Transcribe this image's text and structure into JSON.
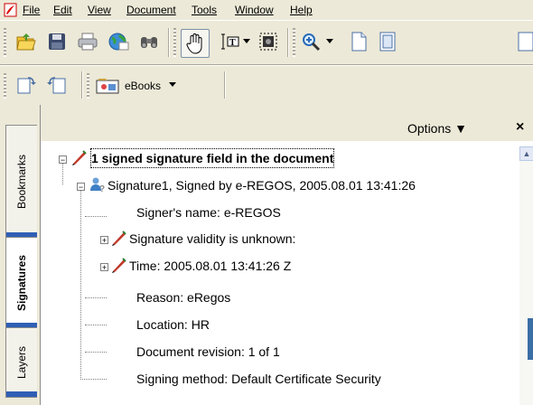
{
  "menu": {
    "items": [
      {
        "label": "File"
      },
      {
        "label": "Edit"
      },
      {
        "label": "View"
      },
      {
        "label": "Document"
      },
      {
        "label": "Tools"
      },
      {
        "label": "Window"
      },
      {
        "label": "Help"
      }
    ]
  },
  "toolbar": {
    "ebooks_label": "eBooks"
  },
  "tabs": {
    "bookmarks": "Bookmarks",
    "signatures": "Signatures",
    "layers": "Layers"
  },
  "panel": {
    "options_label": "Options ▼",
    "close_label": "×"
  },
  "tree": {
    "root": "1 signed signature field in the document",
    "signature": "Signature1, Signed by e-REGOS, 2005.08.01 13:41:26",
    "signer": "Signer's name: e-REGOS",
    "validity": "Signature validity is unknown:",
    "time": "Time: 2005.08.01 13:41:26 Z",
    "reason": "Reason: eRegos",
    "location": "Location: HR",
    "revision": "Document revision: 1 of 1",
    "method": "Signing method: Default Certificate Security"
  },
  "colors": {
    "chrome": "#ece9d8",
    "tab_stripe": "#2f5fb5",
    "pen_red": "#c0392b",
    "pen_green": "#2e7d32"
  }
}
